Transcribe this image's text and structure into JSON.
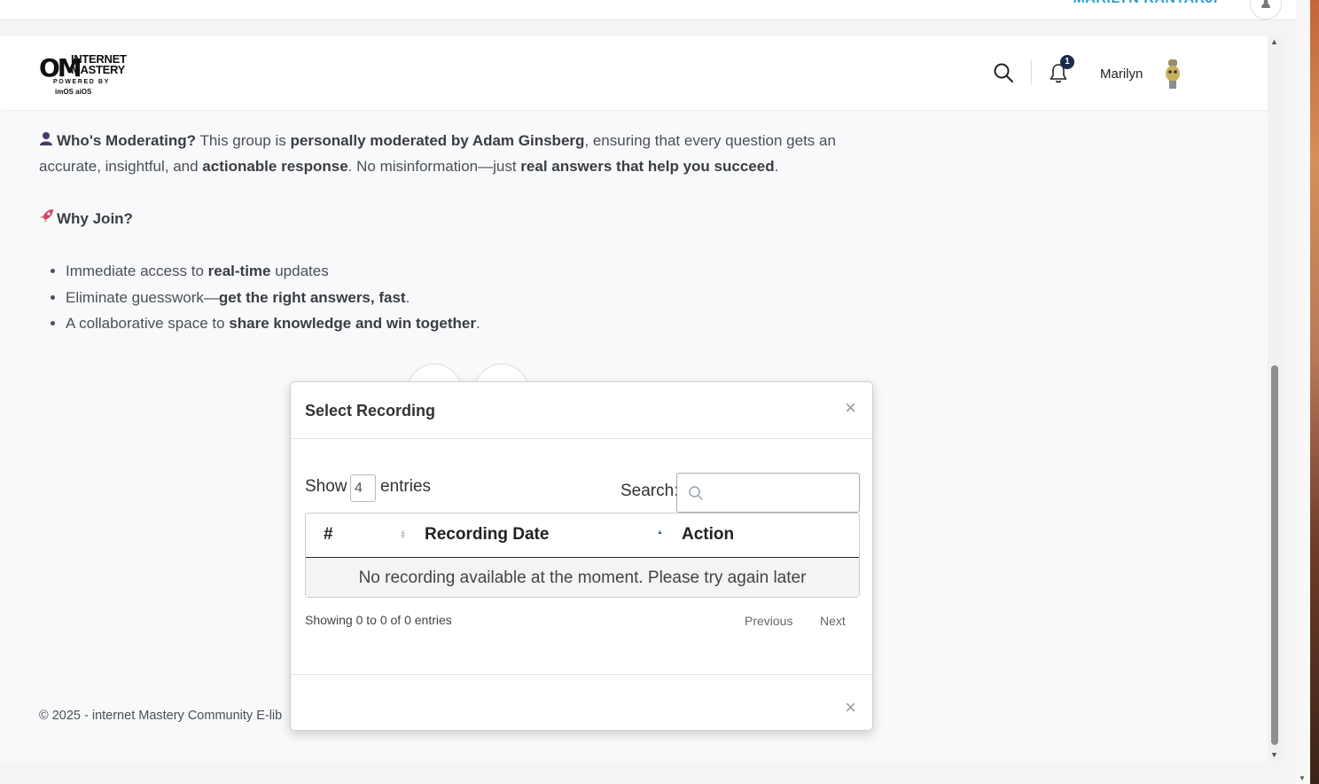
{
  "top_bar": {
    "user_name": "MARILYN KANTARJI"
  },
  "header": {
    "logo": {
      "line1": "INTERNET",
      "line2": "MASTERY",
      "line3": "POWERED BY",
      "line4": "imOS   aiOS"
    },
    "notification_count": "1",
    "user_name": "Marilyn"
  },
  "content": {
    "moderating_heading": "Who's Moderating?",
    "moderating_t1": " This group is ",
    "moderating_b1": "personally moderated by Adam Ginsberg",
    "moderating_t2": ", ensuring that every question gets an accurate, insightful, and ",
    "moderating_b2": "actionable response",
    "moderating_t3": ". No misinformation—just ",
    "moderating_b3": "real answers that help you succeed",
    "moderating_t4": ".",
    "why_join": "Why Join?",
    "bullets": [
      {
        "pre": "Immediate access to ",
        "bold": "real-time",
        "post": " updates"
      },
      {
        "pre": "Eliminate guesswork—",
        "bold": "get the right answers, fast",
        "post": "."
      },
      {
        "pre": "A collaborative space to ",
        "bold": "share knowledge and win together",
        "post": "."
      }
    ]
  },
  "footer": {
    "text": "© 2025 - internet Mastery Community E-lib"
  },
  "modal": {
    "title": "Select Recording",
    "close_symbol": "×",
    "show_label": "Show",
    "show_value": "4",
    "entries_label": "entries",
    "search_label": "Search:",
    "search_value": "",
    "columns": [
      "#",
      "Recording Date",
      "Action"
    ],
    "empty_message": "No recording available at the moment. Please try again later",
    "info": "Showing 0 to 0 of 0 entries",
    "previous": "Previous",
    "next": "Next"
  }
}
